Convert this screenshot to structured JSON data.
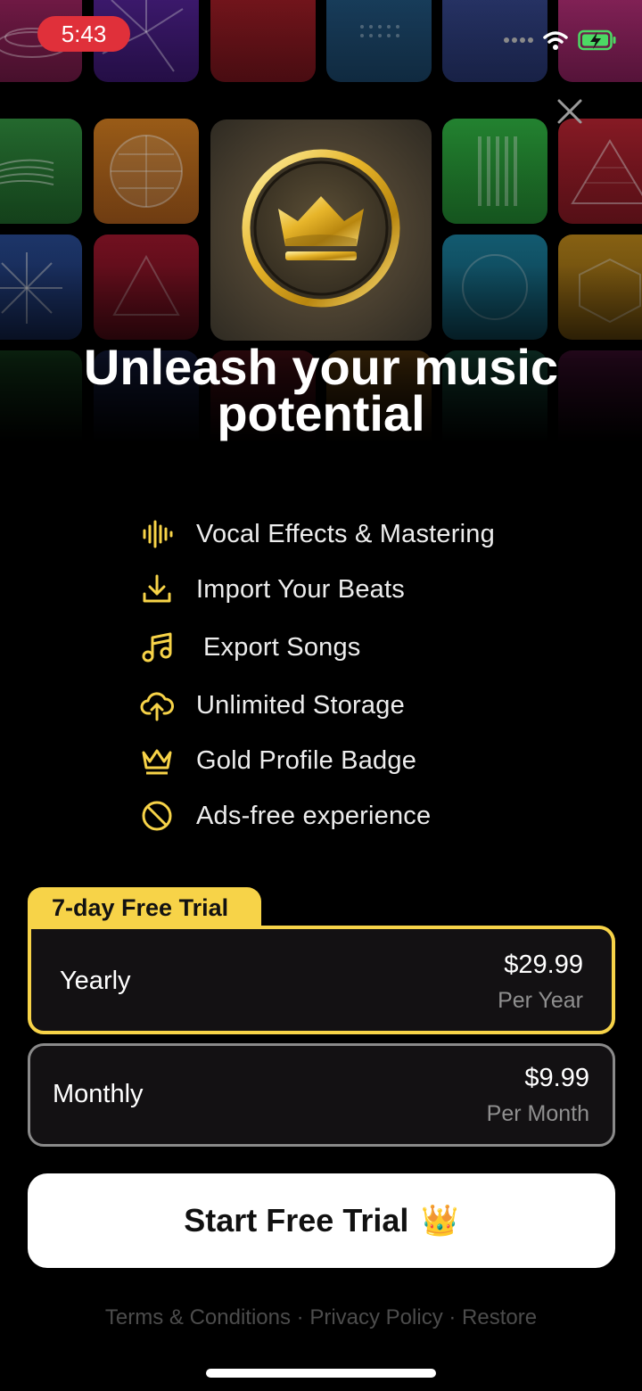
{
  "status_bar": {
    "time": "5:43"
  },
  "headline": {
    "line1": "Unleash your music",
    "line2": "potential"
  },
  "features": [
    {
      "icon": "waveform-icon",
      "label": "Vocal Effects & Mastering"
    },
    {
      "icon": "download-icon",
      "label": "Import Your Beats"
    },
    {
      "icon": "music-note-icon",
      "label": "Export Songs"
    },
    {
      "icon": "cloud-upload-icon",
      "label": "Unlimited Storage"
    },
    {
      "icon": "crown-icon",
      "label": "Gold Profile Badge"
    },
    {
      "icon": "no-ads-icon",
      "label": "Ads-free experience"
    }
  ],
  "plans": {
    "badge": "7-day Free Trial",
    "yearly": {
      "name": "Yearly",
      "price": "$29.99",
      "period": "Per Year",
      "selected": true
    },
    "monthly": {
      "name": "Monthly",
      "price": "$9.99",
      "period": "Per Month",
      "selected": false
    }
  },
  "cta": {
    "label": "Start Free Trial",
    "emoji": "👑"
  },
  "footer": {
    "terms": "Terms & Conditions",
    "sep": " · ",
    "privacy": "Privacy Policy",
    "restore": "Restore"
  },
  "colors": {
    "accent_gold": "#f7d348",
    "background": "#000000",
    "time_pill": "#e0303a"
  }
}
